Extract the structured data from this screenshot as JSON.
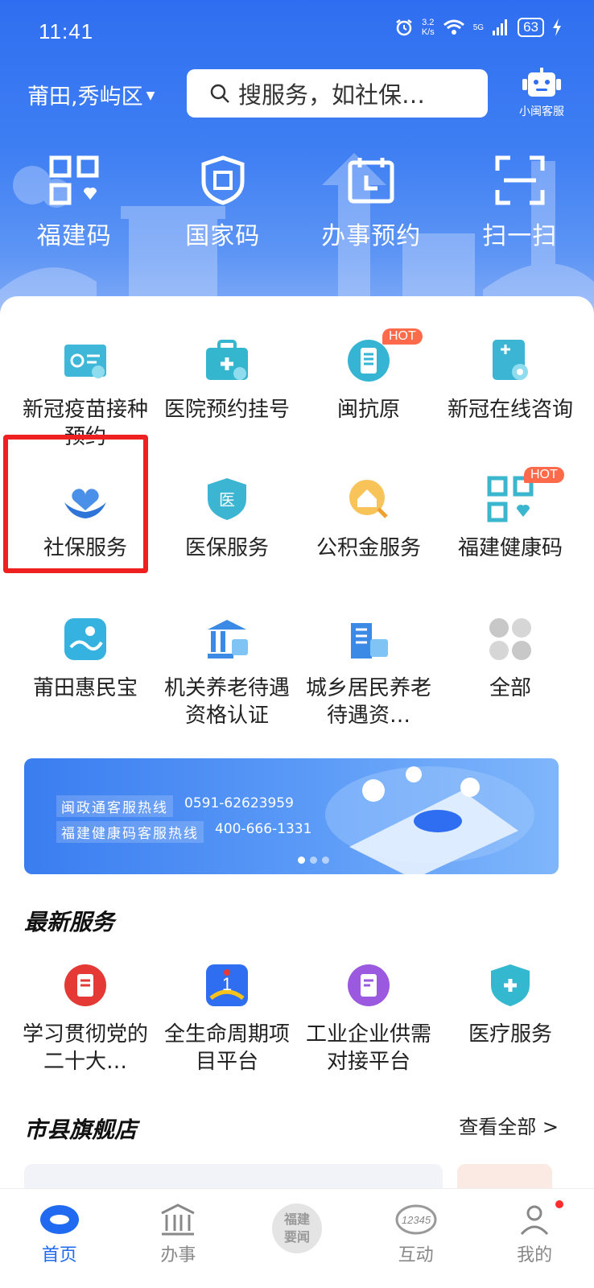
{
  "status": {
    "time": "11:41",
    "speed_value": "3.2",
    "speed_unit": "K/s",
    "signal": "5G",
    "battery": "63"
  },
  "header": {
    "city": "莆田,秀屿区",
    "search_placeholder": "搜服务，如社保…",
    "service_label": "小闽客服"
  },
  "quick_actions": [
    "福建码",
    "国家码",
    "办事预约",
    "扫一扫"
  ],
  "grid": {
    "row1": [
      {
        "label": "新冠疫苗接种预约"
      },
      {
        "label": "医院预约挂号"
      },
      {
        "label": "闽抗原",
        "badge": "HOT"
      },
      {
        "label": "新冠在线咨询"
      }
    ],
    "row2": [
      {
        "label": "社保服务"
      },
      {
        "label": "医保服务"
      },
      {
        "label": "公积金服务"
      },
      {
        "label": "福建健康码",
        "badge": "HOT"
      }
    ],
    "row3": [
      {
        "label": "莆田惠民宝"
      },
      {
        "label": "机关养老待遇资格认证"
      },
      {
        "label": "城乡居民养老待遇资…"
      },
      {
        "label": "全部"
      }
    ]
  },
  "banner": {
    "line1_label": "闽政通客服热线",
    "line1_number": "0591-62623959",
    "line2_label": "福建健康码客服热线",
    "line2_number": "400-666-1331"
  },
  "latest": {
    "title": "最新服务",
    "items": [
      "学习贯彻党的二十大…",
      "全生命周期项目平台",
      "工业企业供需对接平台",
      "医疗服务"
    ]
  },
  "stores": {
    "title": "市县旗舰店",
    "see_all": "查看全部 >"
  },
  "tabbar": {
    "home": "首页",
    "affairs": "办事",
    "news_line1": "福建",
    "news_line2": "要闻",
    "interact": "互动",
    "interact_badge": "12345",
    "mine": "我的"
  },
  "colors": {
    "primary": "#2f6ef0",
    "hot": "#ff6a4a",
    "highlight": "#ee2020"
  }
}
